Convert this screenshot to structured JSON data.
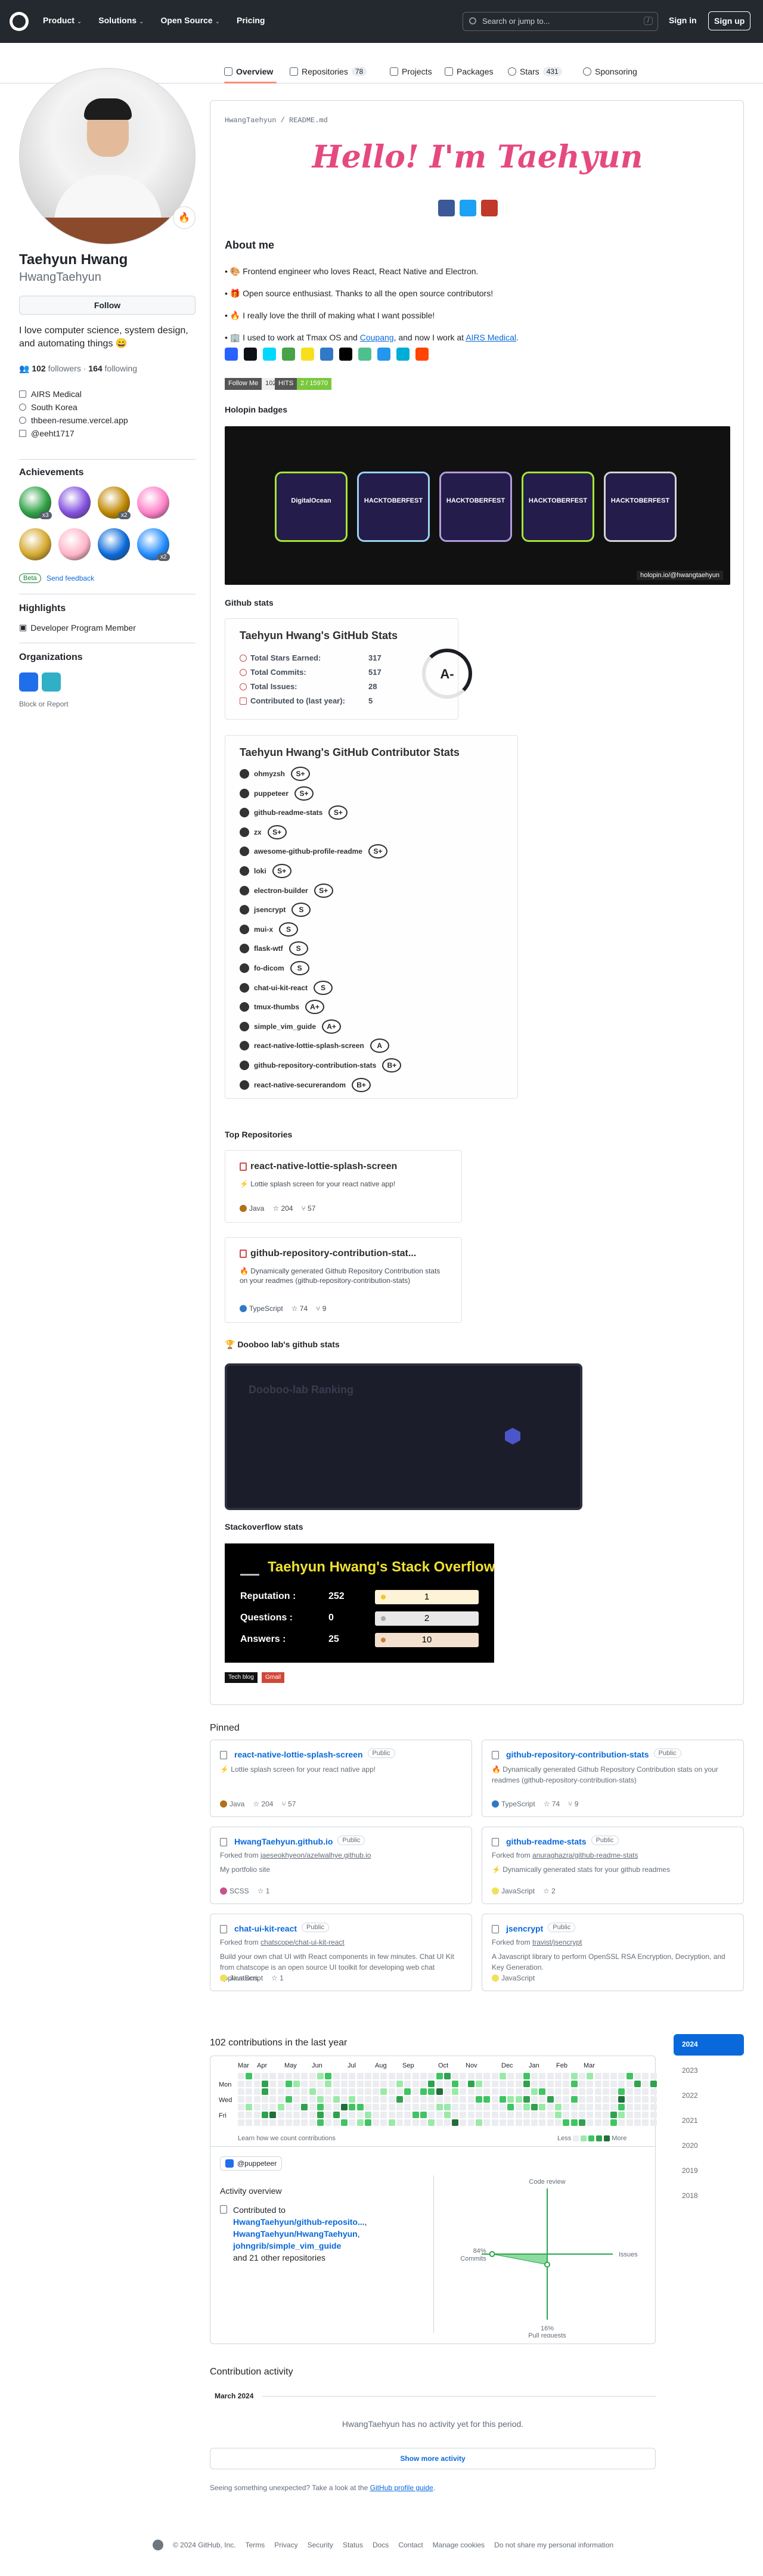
{
  "topbar": {
    "nav": [
      "Product",
      "Solutions",
      "Open Source",
      "Pricing"
    ],
    "search_placeholder": "Search or jump to...",
    "search_key": "/",
    "signin": "Sign in",
    "signup": "Sign up"
  },
  "tabs": [
    {
      "label": "Overview",
      "count": ""
    },
    {
      "label": "Repositories",
      "count": "78"
    },
    {
      "label": "Projects",
      "count": ""
    },
    {
      "label": "Packages",
      "count": ""
    },
    {
      "label": "Stars",
      "count": "431"
    },
    {
      "label": "Sponsoring",
      "count": ""
    }
  ],
  "profile": {
    "name": "Taehyun Hwang",
    "login": "HwangTaehyun",
    "emoji": "🔥",
    "follow": "Follow",
    "bio": "I love computer science, system design, and automating things 😄",
    "followers_count": "102",
    "followers_label": "followers",
    "following_count": "164",
    "following_label": "following",
    "company": "AIRS Medical",
    "location": "South Korea",
    "website": "thbeen-resume.vercel.app",
    "twitter": "@eeht1717"
  },
  "achievements": {
    "title": "Achievements",
    "badges": [
      {
        "name": "pull-shark",
        "color": "#2ea043",
        "count": "x3"
      },
      {
        "name": "galaxy-brain",
        "color": "#8250df",
        "count": ""
      },
      {
        "name": "starstruck",
        "color": "#bf8700",
        "count": "x2"
      },
      {
        "name": "yolo",
        "color": "#ff80c8",
        "count": ""
      },
      {
        "name": "quickdraw",
        "color": "#d4a72c",
        "count": ""
      },
      {
        "name": "heart-on-sleeve",
        "color": "#ffb3c8",
        "count": ""
      },
      {
        "name": "arctic-code-vault",
        "color": "#0969da",
        "count": ""
      },
      {
        "name": "public-sponsor",
        "color": "#218bff",
        "count": "x2"
      }
    ],
    "beta": "Beta",
    "feedback": "Send feedback"
  },
  "highlights": {
    "title": "Highlights",
    "item": "Developer Program Member"
  },
  "organizations": {
    "title": "Organizations",
    "block": "Block or Report"
  },
  "readme": {
    "path_user": "HwangTaehyun",
    "path_file": "README",
    "path_ext": ".md",
    "hello": "Hello! I'm Taehyun",
    "social_colors": [
      "#3b5998",
      "#1da1f2",
      "#c0392b"
    ],
    "about_title": "About me",
    "bullets": [
      {
        "text": "🎨 Frontend engineer who loves React, React Native and Electron.",
        "link": "",
        "tail": "",
        "link2": "",
        "tail2": ""
      },
      {
        "text": "🎁 Open source enthusiast. Thanks to all the open source contributors!",
        "link": "",
        "tail": "",
        "link2": "",
        "tail2": ""
      },
      {
        "text": "🔥 I really love the thrill of making what I want possible!",
        "link": "",
        "tail": "",
        "link2": "",
        "tail2": ""
      },
      {
        "text": "🏢 I used to work at Tmax OS and ",
        "link": "Coupang",
        "tail": ", and now I work at ",
        "link2": "AIRS Medical",
        "tail2": "."
      }
    ],
    "tech_colors": [
      "#2962ff",
      "#0d1117",
      "#00d8ff",
      "#47a248",
      "#f7df1e",
      "#3178c6",
      "#000000",
      "#4fc08d",
      "#2496ed",
      "#00add8",
      "#ff4500"
    ],
    "follow_badge": {
      "label": "Follow Me",
      "count": "102"
    },
    "hits_badge": {
      "label": "HITS",
      "value": "2 / 15970"
    },
    "holopin_title": "Holopin badges",
    "holopin_credit": "holopin.io/@hwangtaehyun",
    "holopin_badges": [
      {
        "label": "DigitalOcean",
        "color": "#a3e635"
      },
      {
        "label": "HACKTOBERFEST",
        "color": "#9ad3f2"
      },
      {
        "label": "HACKTOBERFEST",
        "color": "#b39ddb"
      },
      {
        "label": "HACKTOBERFEST",
        "color": "#a3e635"
      },
      {
        "label": "HACKTOBERFEST",
        "color": "#d4d4d4"
      }
    ],
    "github_stats_title": "Github stats",
    "stats_card": {
      "title": "Taehyun Hwang's GitHub Stats",
      "rows": [
        {
          "label": "Total Stars Earned:",
          "value": "317"
        },
        {
          "label": "Total Commits:",
          "value": "517"
        },
        {
          "label": "Total Issues:",
          "value": "28"
        },
        {
          "label": "Contributed to (last year):",
          "value": "5"
        }
      ],
      "grade": "A-"
    },
    "contrib_card": {
      "title": "Taehyun Hwang's GitHub Contributor Stats",
      "rows": [
        {
          "repo": "ohmyzsh",
          "rank": "S+"
        },
        {
          "repo": "puppeteer",
          "rank": "S+"
        },
        {
          "repo": "github-readme-stats",
          "rank": "S+"
        },
        {
          "repo": "zx",
          "rank": "S+"
        },
        {
          "repo": "awesome-github-profile-readme",
          "rank": "S+"
        },
        {
          "repo": "loki",
          "rank": "S+"
        },
        {
          "repo": "electron-builder",
          "rank": "S+"
        },
        {
          "repo": "jsencrypt",
          "rank": "S"
        },
        {
          "repo": "mui-x",
          "rank": "S"
        },
        {
          "repo": "flask-wtf",
          "rank": "S"
        },
        {
          "repo": "fo-dicom",
          "rank": "S"
        },
        {
          "repo": "chat-ui-kit-react",
          "rank": "S"
        },
        {
          "repo": "tmux-thumbs",
          "rank": "A+"
        },
        {
          "repo": "simple_vim_guide",
          "rank": "A+"
        },
        {
          "repo": "react-native-lottie-splash-screen",
          "rank": "A"
        },
        {
          "repo": "github-repository-contribution-stats",
          "rank": "B+"
        },
        {
          "repo": "react-native-securerandom",
          "rank": "B+"
        }
      ]
    },
    "top_repos_title": "Top Repositories",
    "top_repos": [
      {
        "name": "react-native-lottie-splash-screen",
        "desc": "⚡ Lottie splash screen for your react native app!",
        "lang": "Java",
        "lang_color": "#b07219",
        "stars": "204",
        "forks": "57"
      },
      {
        "name": "github-repository-contribution-stat...",
        "desc": "🔥 Dynamically generated Github Repository Contribution stats on your readmes (github-repository-contribution-stats)",
        "lang": "TypeScript",
        "lang_color": "#3178c6",
        "stars": "74",
        "forks": "9"
      }
    ],
    "dooboo_title": "🏆 Dooboo lab's github stats",
    "dooboo_inner": "Dooboo-lab Ranking",
    "sof_title": "Stackoverflow stats",
    "sof": {
      "title": "Taehyun Hwang's Stack Overflow Stats",
      "rows": [
        {
          "label": "Reputation :",
          "value": "252",
          "badge": "1",
          "color": "#f4c430"
        },
        {
          "label": "Questions :",
          "value": "0",
          "badge": "2",
          "color": "#aaaaaa"
        },
        {
          "label": "Answers :",
          "value": "25",
          "badge": "10",
          "color": "#cd7f32"
        }
      ]
    },
    "blog_badge": "Tech blog",
    "gmail_badge": "Gmail"
  },
  "pinned": {
    "title": "Pinned",
    "public_label": "Public",
    "items": [
      {
        "name": "react-native-lottie-splash-screen",
        "fork": "",
        "fork_link": "",
        "desc": "⚡ Lottie splash screen for your react native app!",
        "lang": "Java",
        "lang_color": "#b07219",
        "stars": "204",
        "forks": "57"
      },
      {
        "name": "github-repository-contribution-stats",
        "fork": "",
        "fork_link": "",
        "desc": "🔥 Dynamically generated Github Repository Contribution stats on your readmes (github-repository-contribution-stats)",
        "lang": "TypeScript",
        "lang_color": "#3178c6",
        "stars": "74",
        "forks": "9"
      },
      {
        "name": "HwangTaehyun.github.io",
        "fork": "Forked from ",
        "fork_link": "jaeseokhyeon/azelwalhye.github.io",
        "desc": "My portfolio site",
        "lang": "SCSS",
        "lang_color": "#c6538c",
        "stars": "1",
        "forks": ""
      },
      {
        "name": "github-readme-stats",
        "fork": "Forked from ",
        "fork_link": "anuraghazra/github-readme-stats",
        "desc": "⚡ Dynamically generated stats for your github readmes",
        "lang": "JavaScript",
        "lang_color": "#f1e05a",
        "stars": "2",
        "forks": ""
      },
      {
        "name": "chat-ui-kit-react",
        "fork": "Forked from ",
        "fork_link": "chatscope/chat-ui-kit-react",
        "desc": "Build your own chat UI with React components in few minutes. Chat UI Kit from chatscope is an open source UI toolkit for developing web chat applications.",
        "lang": "JavaScript",
        "lang_color": "#f1e05a",
        "stars": "1",
        "forks": ""
      },
      {
        "name": "jsencrypt",
        "fork": "Forked from ",
        "fork_link": "travist/jsencrypt",
        "desc": "A Javascript library to perform OpenSSL RSA Encryption, Decryption, and Key Generation.",
        "lang": "JavaScript",
        "lang_color": "#f1e05a",
        "stars": "",
        "forks": ""
      }
    ]
  },
  "contributions": {
    "title": "102 contributions in the last year",
    "months": [
      "Mar",
      "Apr",
      "May",
      "Jun",
      "Jul",
      "Aug",
      "Sep",
      "Oct",
      "Nov",
      "Dec",
      "Jan",
      "Feb",
      "Mar"
    ],
    "days": [
      "Mon",
      "Wed",
      "Fri"
    ],
    "learn": "Learn how we count contributions",
    "less": "Less",
    "more": "More",
    "level_colors": [
      "#ebedf0",
      "#9be9a8",
      "#40c463",
      "#30a14e",
      "#216e39"
    ],
    "years": [
      "2024",
      "2023",
      "2022",
      "2021",
      "2020",
      "2019",
      "2018"
    ]
  },
  "overview": {
    "org": "@puppeteer",
    "title": "Activity overview",
    "contributed_to": "Contributed to",
    "repo1": "HwangTaehyun/github-reposito...",
    "repo2": "HwangTaehyun/HwangTaehyun",
    "repo3": "johngrib/simple_vim_guide",
    "others": "and 21 other repositories",
    "code_review": "Code review",
    "issues": "Issues",
    "pull_requests": "Pull requests",
    "commits": "Commits",
    "commits_pct": "84%",
    "pr_pct": "16%",
    "commits_value": 84,
    "pr_value": 16
  },
  "activity": {
    "title": "Contribution activity",
    "month": "March 2024",
    "none": "HwangTaehyun has no activity yet for this period.",
    "show_more": "Show more activity",
    "seeing": "Seeing something unexpected? Take a look at the ",
    "guide": "GitHub profile guide",
    "guide_tail": "."
  },
  "footer": [
    "© 2024 GitHub, Inc.",
    "Terms",
    "Privacy",
    "Security",
    "Status",
    "Docs",
    "Contact",
    "Manage cookies",
    "Do not share my personal information"
  ]
}
